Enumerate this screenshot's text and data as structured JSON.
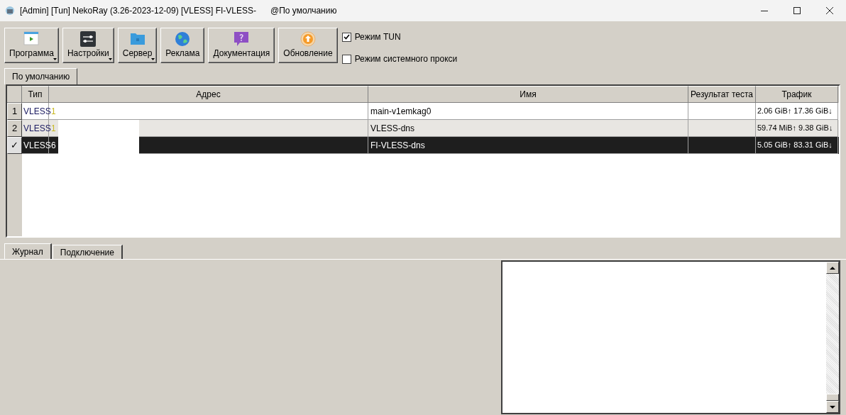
{
  "window": {
    "title": "[Admin] [Tun] NekoRay (3.26-2023-12-09) [VLESS] FI-VLESS-",
    "title_suffix": "@По умолчанию"
  },
  "toolbar": [
    {
      "label": "Программа",
      "kind": "program",
      "dropdown": true
    },
    {
      "label": "Настройки",
      "kind": "settings",
      "dropdown": true
    },
    {
      "label": "Сервер",
      "kind": "server",
      "dropdown": true
    },
    {
      "label": "Реклама",
      "kind": "globe",
      "dropdown": false
    },
    {
      "label": "Документация",
      "kind": "help",
      "dropdown": false
    },
    {
      "label": "Обновление",
      "kind": "update",
      "dropdown": false
    }
  ],
  "options": [
    {
      "label": "Режим TUN",
      "checked": true
    },
    {
      "label": "Режим системного прокси",
      "checked": false
    }
  ],
  "group_tabs": [
    {
      "label": "По умолчанию",
      "selected": true
    }
  ],
  "table": {
    "columns": [
      "Тип",
      "Адрес",
      "Имя",
      "Результат теста",
      "Трафик"
    ],
    "rows": [
      {
        "header": "1",
        "type": "VLESS",
        "address": "1",
        "name": "main-v1emkag0",
        "traffic": "2.06 GiB↑ 17.36 GiB↓",
        "selected": false
      },
      {
        "header": "2",
        "type": "VLESS",
        "address": "1",
        "name": "VLESS-dns",
        "traffic": "59.74 MiB↑ 9.38 GiB↓",
        "selected": false
      },
      {
        "header": "✓",
        "type": "VLESS",
        "address": "6",
        "name": "FI-VLESS-dns",
        "traffic": "5.05 GiB↑ 83.31 GiB↓",
        "selected": true
      }
    ]
  },
  "bottom_tabs": [
    {
      "label": "Журнал",
      "selected": true
    },
    {
      "label": "Подключение",
      "selected": false
    }
  ]
}
